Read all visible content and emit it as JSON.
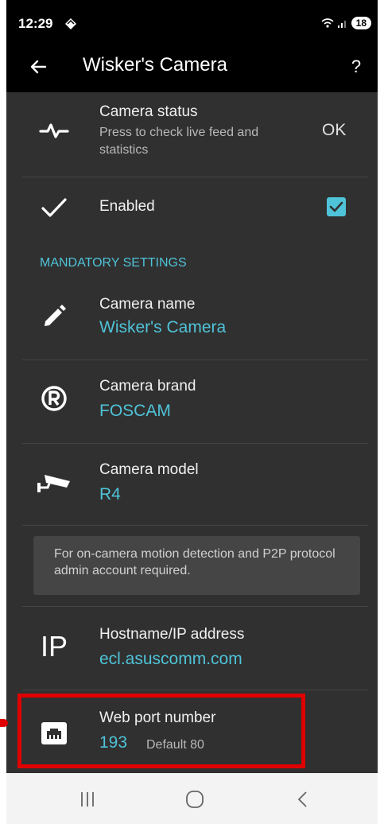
{
  "status_bar": {
    "time": "12:29",
    "battery_level": "18"
  },
  "toolbar": {
    "title": "Wisker's Camera",
    "help_label": "?"
  },
  "camera_status": {
    "title": "Camera status",
    "subtitle": "Press to check live feed and statistics",
    "value": "OK"
  },
  "enabled": {
    "title": "Enabled",
    "checked": true
  },
  "section": {
    "mandatory": "MANDATORY SETTINGS"
  },
  "camera_name": {
    "title": "Camera name",
    "value": "Wisker's Camera"
  },
  "camera_brand": {
    "title": "Camera brand",
    "value": "FOSCAM"
  },
  "camera_model": {
    "title": "Camera model",
    "value": "R4"
  },
  "info": {
    "text": "For on-camera motion detection and P2P protocol admin account required."
  },
  "hostname": {
    "title": "Hostname/IP address",
    "value": "ecl.asuscomm.com",
    "icon_text": "IP"
  },
  "web_port": {
    "title": "Web port number",
    "value": "193",
    "default_note": "Default 80"
  },
  "colors": {
    "accent": "#4fc3d8",
    "background": "#303030",
    "toolbar": "#000000",
    "highlight": "#e00000"
  },
  "icons": {
    "camera_status": "pulse-icon",
    "enabled": "check-icon",
    "camera_name": "pencil-icon",
    "camera_brand": "registered-icon",
    "camera_model": "security-camera-icon",
    "web_port": "ethernet-port-icon"
  }
}
